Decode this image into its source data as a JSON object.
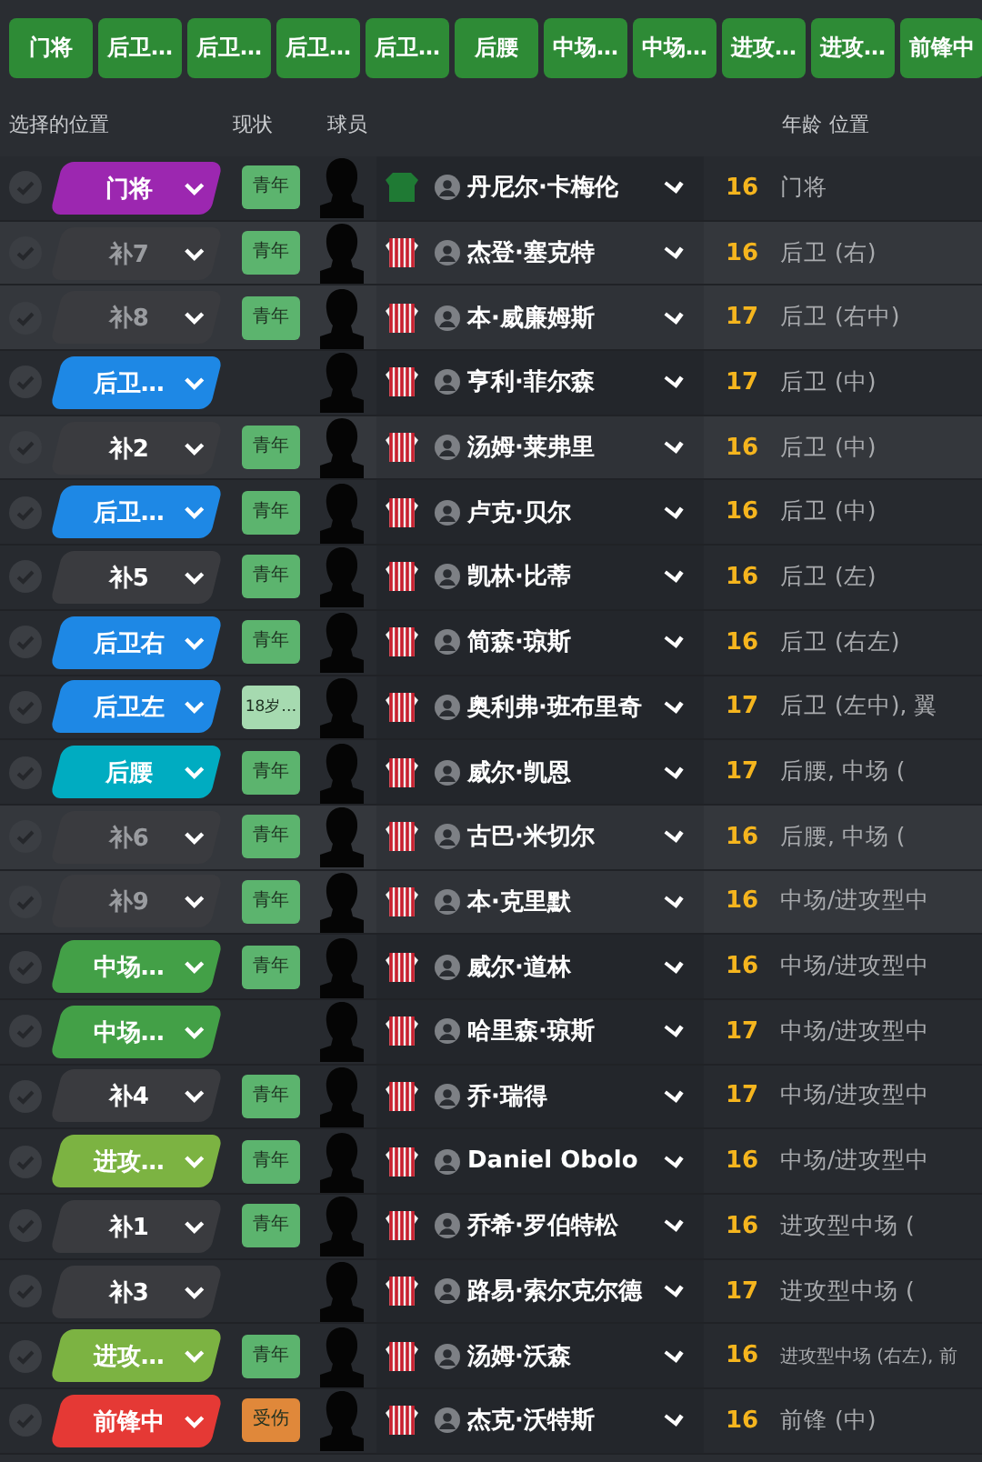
{
  "filter_buttons": [
    "门将",
    "后卫…",
    "后卫…",
    "后卫…",
    "后卫…",
    "后腰",
    "中场…",
    "中场…",
    "进攻…",
    "进攻…",
    "前锋中"
  ],
  "columns": [
    "选择的位置",
    "现状",
    "球员",
    "年龄",
    "位置"
  ],
  "rows": [
    {
      "position": {
        "label": "门将",
        "color": "#9c27b0",
        "muted": false
      },
      "highlighted": false,
      "status": {
        "kind": "youth",
        "label": "青年"
      },
      "kit": {
        "kind": "goalkeeper"
      },
      "name": "丹尼尔·卡梅伦",
      "age": "16",
      "role": "门将"
    },
    {
      "position": {
        "label": "补7",
        "color": "#3a3b3f",
        "muted": true
      },
      "highlighted": true,
      "status": {
        "kind": "youth",
        "label": "青年"
      },
      "kit": {
        "kind": "striped"
      },
      "name": "杰登·塞克特",
      "age": "16",
      "role": "后卫 (右)"
    },
    {
      "position": {
        "label": "补8",
        "color": "#3a3b3f",
        "muted": true
      },
      "highlighted": true,
      "status": {
        "kind": "youth",
        "label": "青年"
      },
      "kit": {
        "kind": "striped"
      },
      "name": "本·威廉姆斯",
      "age": "17",
      "role": "后卫 (右中)"
    },
    {
      "position": {
        "label": "后卫…",
        "color": "#1e88e5",
        "muted": false
      },
      "highlighted": false,
      "kit": {
        "kind": "striped"
      },
      "name": "亨利·菲尔森",
      "age": "17",
      "role": "后卫 (中)"
    },
    {
      "position": {
        "label": "补2",
        "color": "#3a3b3f",
        "muted": false
      },
      "highlighted": true,
      "status": {
        "kind": "youth",
        "label": "青年"
      },
      "kit": {
        "kind": "striped"
      },
      "name": "汤姆·莱弗里",
      "age": "16",
      "role": "后卫 (中)"
    },
    {
      "position": {
        "label": "后卫…",
        "color": "#1e88e5",
        "muted": false
      },
      "highlighted": false,
      "status": {
        "kind": "youth",
        "label": "青年"
      },
      "kit": {
        "kind": "striped"
      },
      "name": "卢克·贝尔",
      "age": "16",
      "role": "后卫 (中)"
    },
    {
      "position": {
        "label": "补5",
        "color": "#3a3b3f",
        "muted": false
      },
      "highlighted": false,
      "status": {
        "kind": "youth",
        "label": "青年"
      },
      "kit": {
        "kind": "striped"
      },
      "name": "凯林·比蒂",
      "age": "16",
      "role": "后卫 (左)"
    },
    {
      "position": {
        "label": "后卫右",
        "color": "#1e88e5",
        "muted": false
      },
      "highlighted": false,
      "status": {
        "kind": "youth",
        "label": "青年"
      },
      "kit": {
        "kind": "striped"
      },
      "name": "简森·琼斯",
      "age": "16",
      "role": "后卫 (右左)"
    },
    {
      "position": {
        "label": "后卫左",
        "color": "#1e88e5",
        "muted": false
      },
      "highlighted": false,
      "status": {
        "kind": "note",
        "label": "18岁…"
      },
      "kit": {
        "kind": "striped"
      },
      "name": "奥利弗·班布里奇",
      "age": "17",
      "role": "后卫 (左中), 翼"
    },
    {
      "position": {
        "label": "后腰",
        "color": "#00acc1",
        "muted": false
      },
      "highlighted": false,
      "status": {
        "kind": "youth",
        "label": "青年"
      },
      "kit": {
        "kind": "striped"
      },
      "name": "威尔·凯恩",
      "age": "17",
      "role": "后腰, 中场 ("
    },
    {
      "position": {
        "label": "补6",
        "color": "#3a3b3f",
        "muted": true
      },
      "highlighted": true,
      "status": {
        "kind": "youth",
        "label": "青年"
      },
      "kit": {
        "kind": "striped"
      },
      "name": "古巴·米切尔",
      "age": "16",
      "role": "后腰, 中场 ("
    },
    {
      "position": {
        "label": "补9",
        "color": "#3a3b3f",
        "muted": true
      },
      "highlighted": true,
      "status": {
        "kind": "youth",
        "label": "青年"
      },
      "kit": {
        "kind": "striped"
      },
      "name": "本·克里默",
      "age": "16",
      "role": "中场/进攻型中"
    },
    {
      "position": {
        "label": "中场…",
        "color": "#43a047",
        "muted": false
      },
      "highlighted": false,
      "status": {
        "kind": "youth",
        "label": "青年"
      },
      "kit": {
        "kind": "striped"
      },
      "name": "威尔·道林",
      "age": "16",
      "role": "中场/进攻型中"
    },
    {
      "position": {
        "label": "中场…",
        "color": "#43a047",
        "muted": false
      },
      "highlighted": false,
      "kit": {
        "kind": "striped"
      },
      "name": "哈里森·琼斯",
      "age": "17",
      "role": "中场/进攻型中"
    },
    {
      "position": {
        "label": "补4",
        "color": "#3a3b3f",
        "muted": false
      },
      "highlighted": false,
      "status": {
        "kind": "youth",
        "label": "青年"
      },
      "kit": {
        "kind": "striped"
      },
      "name": "乔·瑞得",
      "age": "17",
      "role": "中场/进攻型中"
    },
    {
      "position": {
        "label": "进攻…",
        "color": "#7cb342",
        "muted": false
      },
      "highlighted": false,
      "status": {
        "kind": "youth",
        "label": "青年"
      },
      "kit": {
        "kind": "striped"
      },
      "name": "Daniel Obolo",
      "age": "16",
      "role": "中场/进攻型中"
    },
    {
      "position": {
        "label": "补1",
        "color": "#3a3b3f",
        "muted": false
      },
      "highlighted": false,
      "status": {
        "kind": "youth",
        "label": "青年"
      },
      "kit": {
        "kind": "striped"
      },
      "name": "乔希·罗伯特松",
      "age": "16",
      "role": "进攻型中场 ("
    },
    {
      "position": {
        "label": "补3",
        "color": "#3a3b3f",
        "muted": false
      },
      "highlighted": false,
      "kit": {
        "kind": "striped"
      },
      "name": "路易·索尔克尔德",
      "age": "17",
      "role": "进攻型中场 ("
    },
    {
      "position": {
        "label": "进攻…",
        "color": "#7cb342",
        "muted": false
      },
      "highlighted": false,
      "status": {
        "kind": "youth",
        "label": "青年"
      },
      "kit": {
        "kind": "striped"
      },
      "name": "汤姆·沃森",
      "age": "16",
      "role": "进攻型中场 (右左), 前"
    },
    {
      "position": {
        "label": "前锋中",
        "color": "#e53935",
        "muted": false
      },
      "highlighted": false,
      "status": {
        "kind": "injured",
        "label": "受伤"
      },
      "kit": {
        "kind": "striped"
      },
      "name": "杰克·沃特斯",
      "age": "16",
      "role": "前锋 (中)"
    }
  ]
}
